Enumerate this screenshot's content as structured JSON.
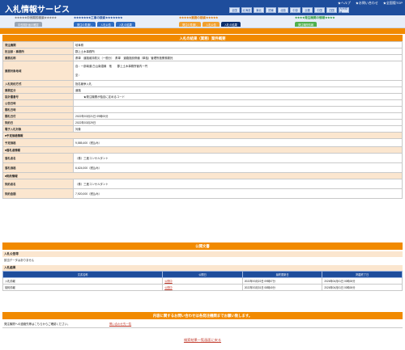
{
  "header": {
    "title": "入札情報サービス",
    "links": [
      "ヘルプ",
      "お問い合わせ",
      "全国版TOP"
    ],
    "regions": [
      "全国",
      "北海道",
      "東北",
      "関東",
      "北陸",
      "中部",
      "近畿",
      "中国",
      "四国",
      "九州沖縄"
    ]
  },
  "nav": {
    "groups": [
      {
        "label": "中長期的検索",
        "stars_left": "★★★★★",
        "stars_right": "★★★★★",
        "color": "#7a7a7a",
        "tabs": [
          "中長期計画の確認"
        ],
        "tab_colors": [
          "#9aa6b5"
        ]
      },
      {
        "label": "工事の検索",
        "stars_left": "★★★★★★★",
        "stars_right": "★★★★★★★",
        "color": "#1e4d9c",
        "tabs": [
          "発注の見通し",
          "入札公告",
          "入札の結果"
        ],
        "tab_colors": [
          "#2f6cc1",
          "#2f6cc1",
          "#2f6cc1"
        ]
      },
      {
        "label": "業務の検索",
        "stars_left": "★★★★★",
        "stars_right": "★★★★★",
        "color": "#e07b00",
        "tabs": [
          "発注の見通し",
          "入札公告",
          "入札の結果"
        ],
        "tab_colors": [
          "#f0a030",
          "#f0a030",
          "#0b2f6d"
        ],
        "active_index": 2
      },
      {
        "label": "発注機関の情報",
        "stars_left": "★★★★",
        "stars_right": "★★★★",
        "color": "#2e9a3a",
        "tabs": [
          "発注機関情報"
        ],
        "tab_colors": [
          "#4fb04f"
        ]
      }
    ]
  },
  "detail": {
    "title": "入札の結果（業務）案件概要",
    "rows": [
      {
        "label": "発注機関",
        "value": "岐阜県"
      },
      {
        "label": "担当部・事務所",
        "value": "郡上土木事務所"
      },
      {
        "label": "業務名称",
        "value": "県単　道路維持防災（一般分）　県単　道路施設修繕（単独）管理所施業務委託"
      },
      {
        "label": "業務対象地域",
        "value": "自：一部南道 白山南濃線　他　　郡上土木事務所管内一円",
        "value2": "至："
      },
      {
        "label": "入札契約方式",
        "value": "指名競争入札"
      },
      {
        "label": "業務区分",
        "value": "道路"
      },
      {
        "label": "設計書番号",
        "value": "　　　★発注機関が独自に定めるコード"
      },
      {
        "label": "公告日時",
        "value": ""
      },
      {
        "label": "開札日時",
        "value": ""
      },
      {
        "label": "開札日付",
        "value": "2022年03月21日 09時00分"
      },
      {
        "label": "契約日",
        "value": "2022年03月29日"
      },
      {
        "label": "電子入札対象",
        "value": "対象"
      }
    ],
    "yotei_header": "■予定価格情報",
    "yotei_rows": [
      {
        "label": "予定価格",
        "value": "9,585,400（税込み）"
      }
    ],
    "rakusatsu_header": "■落札者情報",
    "rakusatsu_rows": [
      {
        "label": "落札者名",
        "value": "（株）三進コンサルタント"
      },
      {
        "label": "落札価格",
        "value": "6,624,000（税込み）"
      }
    ],
    "keiyaku_header": "■契約情報",
    "keiyaku_rows": [
      {
        "label": "契約者名",
        "value": "（株）三進コンサルタント"
      },
      {
        "label": "契約金額",
        "value": "7,920,000（税込み）"
      }
    ]
  },
  "kokai": {
    "title": "公開文書",
    "notice_head": "入札公告等",
    "notice_text": "該当データはありません",
    "result_head": "入札結果",
    "columns": [
      "文書名称",
      "公開日",
      "最終更新日",
      "掲載終了日"
    ],
    "rows": [
      {
        "name": "入札情報",
        "link": "公開中",
        "updated": "2022年03月22日 09時07分",
        "end": "2026年04月01日 00時00分"
      },
      {
        "name": "契約情報",
        "link": "公開中",
        "updated": "2022年03月31日 08時40分",
        "end": "2026年04月01日 00時00分"
      }
    ]
  },
  "contact": {
    "title": "内容に関するお問い合わせは各発注機関までお願い致します。",
    "text": "発注機関への連絡先等はこちらからご確認ください。",
    "link": "問い合わせ先一覧"
  },
  "back_link": "検索結果一覧画面に戻る"
}
